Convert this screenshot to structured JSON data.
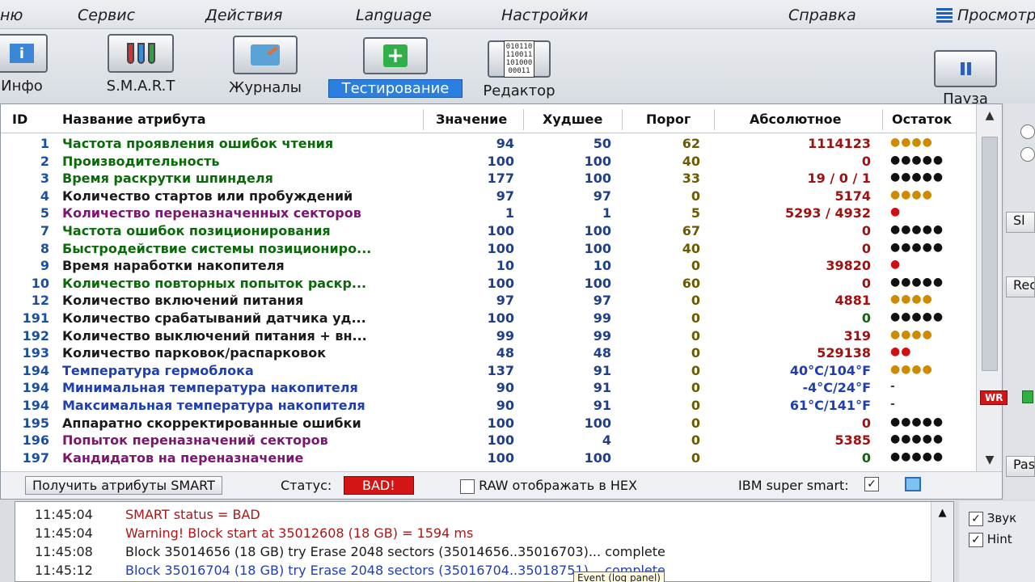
{
  "menu": {
    "items": [
      "ню",
      "Сервис",
      "Действия",
      "Language",
      "Настройки",
      "Справка"
    ],
    "view_label": "Просмотр"
  },
  "toolbar": {
    "buttons": [
      {
        "label": "Инфо",
        "icon": "info-icon"
      },
      {
        "label": "S.M.A.R.T",
        "icon": "test-tubes-icon"
      },
      {
        "label": "Журналы",
        "icon": "folder-icon"
      },
      {
        "label": "Тестирование",
        "icon": "plus-icon",
        "active": true
      },
      {
        "label": "Редактор",
        "icon": "binary-editor-icon"
      }
    ],
    "binary_icon_text": "010110\n110011\n101000\n00011",
    "pause_label": "Пауза"
  },
  "table": {
    "headers": {
      "id": "ID",
      "name": "Название атрибута",
      "value": "Значение",
      "worst": "Худшее",
      "threshold": "Порог",
      "absolute": "Абсолютное",
      "remaining": "Остаток"
    },
    "rows": [
      {
        "id": "1",
        "name": "Частота проявления ошибок чтения",
        "value": "94",
        "worst": "50",
        "threshold": "62",
        "absolute": "1114123",
        "remaining": "●●●●",
        "name_color": "green",
        "abs_color": "red",
        "rem_color": "orange"
      },
      {
        "id": "2",
        "name": "Производительность",
        "value": "100",
        "worst": "100",
        "threshold": "40",
        "absolute": "0",
        "remaining": "●●●●●",
        "name_color": "green",
        "abs_color": "red",
        "rem_color": "black"
      },
      {
        "id": "3",
        "name": "Время раскрутки шпинделя",
        "value": "177",
        "worst": "100",
        "threshold": "33",
        "absolute": "19 / 0 / 1",
        "remaining": "●●●●●",
        "name_color": "green",
        "abs_color": "red",
        "rem_color": "black"
      },
      {
        "id": "4",
        "name": "Количество стартов или пробуждений",
        "value": "97",
        "worst": "97",
        "threshold": "0",
        "absolute": "5174",
        "remaining": "●●●●",
        "name_color": "black",
        "abs_color": "red",
        "rem_color": "orange"
      },
      {
        "id": "5",
        "name": "Количество переназначенных секторов",
        "value": "1",
        "worst": "1",
        "threshold": "5",
        "absolute": "5293 / 4932",
        "remaining": "●",
        "name_color": "purple",
        "abs_color": "red",
        "rem_color": "red"
      },
      {
        "id": "7",
        "name": "Частота ошибок позиционирования",
        "value": "100",
        "worst": "100",
        "threshold": "67",
        "absolute": "0",
        "remaining": "●●●●●",
        "name_color": "green",
        "abs_color": "red",
        "rem_color": "black"
      },
      {
        "id": "8",
        "name": "Быстродействие системы позициониро...",
        "value": "100",
        "worst": "100",
        "threshold": "40",
        "absolute": "0",
        "remaining": "●●●●●",
        "name_color": "green",
        "abs_color": "red",
        "rem_color": "black"
      },
      {
        "id": "9",
        "name": "Время наработки накопителя",
        "value": "10",
        "worst": "10",
        "threshold": "0",
        "absolute": "39820",
        "remaining": "●",
        "name_color": "black",
        "abs_color": "red",
        "rem_color": "red"
      },
      {
        "id": "10",
        "name": "Количество повторных попыток раскр...",
        "value": "100",
        "worst": "100",
        "threshold": "60",
        "absolute": "0",
        "remaining": "●●●●●",
        "name_color": "green",
        "abs_color": "red",
        "rem_color": "black"
      },
      {
        "id": "12",
        "name": "Количество включений питания",
        "value": "97",
        "worst": "97",
        "threshold": "0",
        "absolute": "4881",
        "remaining": "●●●●",
        "name_color": "black",
        "abs_color": "red",
        "rem_color": "orange"
      },
      {
        "id": "191",
        "name": "Количество срабатываний датчика уд...",
        "value": "100",
        "worst": "99",
        "threshold": "0",
        "absolute": "0",
        "remaining": "●●●●●",
        "name_color": "black",
        "abs_color": "green",
        "rem_color": "black"
      },
      {
        "id": "192",
        "name": "Количество выключений питания + вн...",
        "value": "99",
        "worst": "99",
        "threshold": "0",
        "absolute": "319",
        "remaining": "●●●●",
        "name_color": "black",
        "abs_color": "red",
        "rem_color": "orange"
      },
      {
        "id": "193",
        "name": "Количество парковок/распарковок",
        "value": "48",
        "worst": "48",
        "threshold": "0",
        "absolute": "529138",
        "remaining": "●●",
        "name_color": "black",
        "abs_color": "red",
        "rem_color": "red"
      },
      {
        "id": "194",
        "name": "Температура гермоблока",
        "value": "137",
        "worst": "91",
        "threshold": "0",
        "absolute": "40°C/104°F",
        "remaining": "●●●●",
        "name_color": "blue",
        "abs_color": "blue",
        "rem_color": "orange"
      },
      {
        "id": "194",
        "name": "Минимальная температура накопителя",
        "value": "90",
        "worst": "91",
        "threshold": "0",
        "absolute": "-4°C/24°F",
        "remaining": "-",
        "name_color": "blue",
        "abs_color": "blue",
        "rem_color": "gray"
      },
      {
        "id": "194",
        "name": "Максимальная температура накопителя",
        "value": "90",
        "worst": "91",
        "threshold": "0",
        "absolute": "61°C/141°F",
        "remaining": "-",
        "name_color": "blue",
        "abs_color": "blue",
        "rem_color": "gray"
      },
      {
        "id": "195",
        "name": "Аппаратно скорректированные ошибки",
        "value": "100",
        "worst": "100",
        "threshold": "0",
        "absolute": "0",
        "remaining": "●●●●●",
        "name_color": "black",
        "abs_color": "red",
        "rem_color": "black"
      },
      {
        "id": "196",
        "name": "Попыток переназначений секторов",
        "value": "100",
        "worst": "4",
        "threshold": "0",
        "absolute": "5385",
        "remaining": "●●●●●",
        "name_color": "purple",
        "abs_color": "red",
        "rem_color": "black"
      },
      {
        "id": "197",
        "name": "Кандидатов на переназначение",
        "value": "100",
        "worst": "100",
        "threshold": "0",
        "absolute": "0",
        "remaining": "●●●●●",
        "name_color": "purple",
        "abs_color": "green",
        "rem_color": "black"
      }
    ]
  },
  "statusbar": {
    "get_smart_label": "Получить атрибуты SMART",
    "status_label": "Статус:",
    "status_value": "BAD!",
    "hex_label": "RAW отображать в HEX",
    "ibm_label": "IBM super smart:"
  },
  "log": {
    "lines": [
      {
        "time": "11:45:04",
        "message": "SMART status = BAD",
        "color": "red"
      },
      {
        "time": "11:45:04",
        "message": "Warning! Block start at 35012608 (18 GB)  = 1594 ms",
        "color": "red"
      },
      {
        "time": "11:45:08",
        "message": "Block 35014656 (18 GB) try Erase 2048 sectors (35014656..35016703)... complete",
        "color": "black"
      },
      {
        "time": "11:45:12",
        "message": "Block 35016704 (18 GB) try Erase 2048 sectors (35016704..35018751)... complete",
        "color": "blue"
      }
    ],
    "tooltip": "Event (log panel)"
  },
  "sidebar": {
    "buttons": [
      "Sl",
      "Rec",
      "Pass"
    ],
    "wr_badge": "WR",
    "options": [
      "Звук",
      "Hint"
    ]
  },
  "colors": {
    "name": {
      "green": "#0a6a0a",
      "black": "#1a1a1a",
      "purple": "#7a1670",
      "blue": "#1f3fb0"
    },
    "status_bad": "#d41515",
    "active_tab": "#2a7fe0"
  }
}
